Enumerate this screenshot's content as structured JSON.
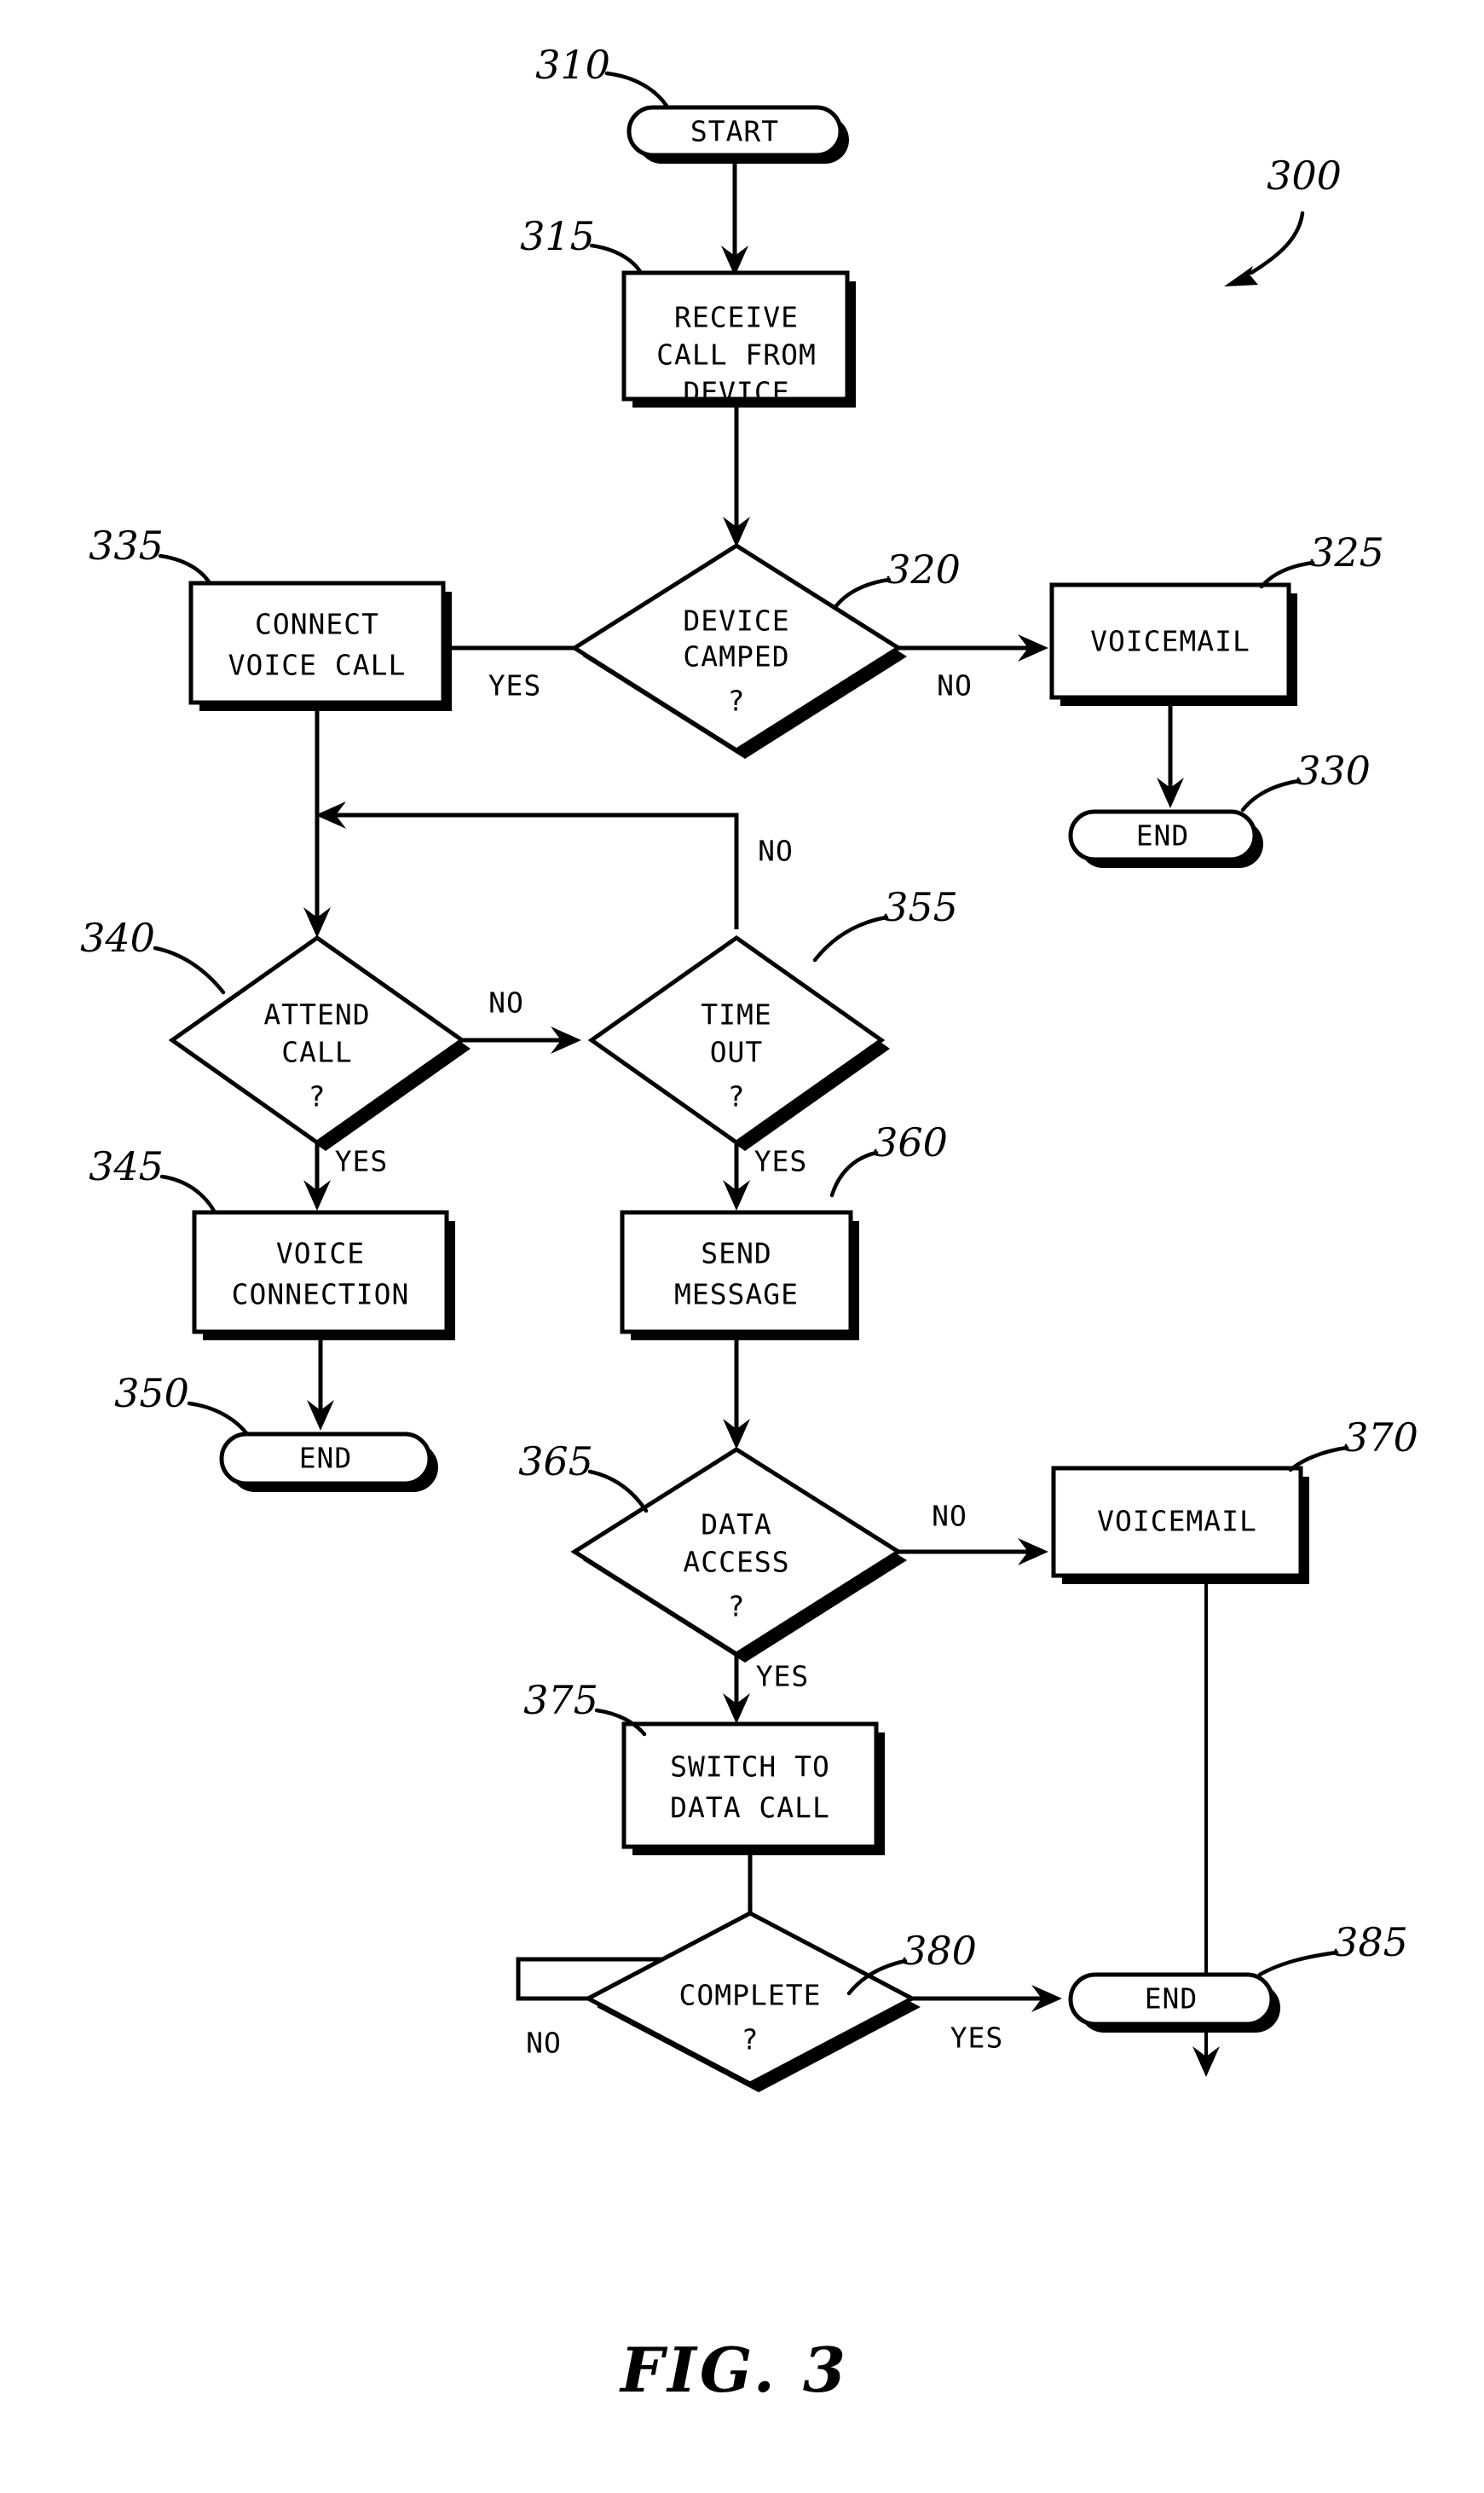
{
  "figure": {
    "caption": "FIG. 3",
    "diagram_ref": "300"
  },
  "nodes": {
    "start": {
      "ref": "310",
      "label": "START",
      "shape": "terminator"
    },
    "receive_call": {
      "ref": "315",
      "label_line1": "RECEIVE",
      "label_line2": "CALL FROM",
      "label_line3": "DEVICE",
      "shape": "process"
    },
    "device_camped": {
      "ref": "320",
      "label_line1": "DEVICE",
      "label_line2": "CAMPED",
      "label_line3": "?",
      "shape": "decision"
    },
    "voicemail_1": {
      "ref": "325",
      "label": "VOICEMAIL",
      "shape": "process"
    },
    "end_1": {
      "ref": "330",
      "label": "END",
      "shape": "terminator"
    },
    "connect_voice_call": {
      "ref": "335",
      "label_line1": "CONNECT",
      "label_line2": "VOICE CALL",
      "shape": "process"
    },
    "attend_call": {
      "ref": "340",
      "label_line1": "ATTEND",
      "label_line2": "CALL",
      "label_line3": "?",
      "shape": "decision"
    },
    "voice_connection": {
      "ref": "345",
      "label_line1": "VOICE",
      "label_line2": "CONNECTION",
      "shape": "process"
    },
    "end_2": {
      "ref": "350",
      "label": "END",
      "shape": "terminator"
    },
    "time_out": {
      "ref": "355",
      "label_line1": "TIME",
      "label_line2": "OUT",
      "label_line3": "?",
      "shape": "decision"
    },
    "send_message": {
      "ref": "360",
      "label_line1": "SEND",
      "label_line2": "MESSAGE",
      "shape": "process"
    },
    "data_access": {
      "ref": "365",
      "label_line1": "DATA",
      "label_line2": "ACCESS",
      "label_line3": "?",
      "shape": "decision"
    },
    "voicemail_2": {
      "ref": "370",
      "label": "VOICEMAIL",
      "shape": "process"
    },
    "switch_to_data_call": {
      "ref": "375",
      "label_line1": "SWITCH TO",
      "label_line2": "DATA CALL",
      "shape": "process"
    },
    "complete": {
      "ref": "380",
      "label": "COMPLETE",
      "label_line2": "?",
      "shape": "decision"
    },
    "end_3": {
      "ref": "385",
      "label": "END",
      "shape": "terminator"
    }
  },
  "branch_labels": {
    "camped_yes": "YES",
    "camped_no": "NO",
    "attend_no": "NO",
    "attend_yes": "YES",
    "timeout_no": "NO",
    "timeout_yes": "YES",
    "data_access_no": "NO",
    "data_access_yes": "YES",
    "complete_no": "NO",
    "complete_yes": "YES"
  },
  "colors": {
    "ink": "#000000",
    "paper": "#ffffff"
  }
}
